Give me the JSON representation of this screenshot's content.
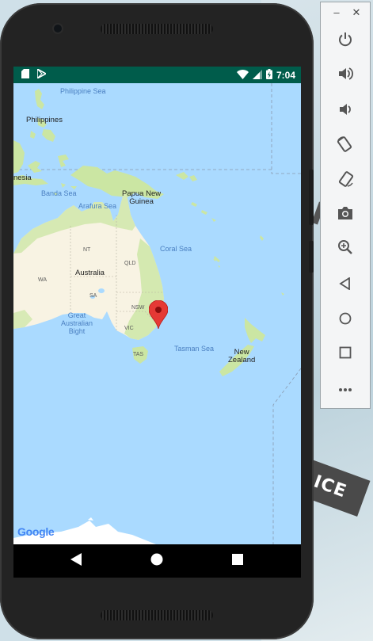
{
  "status_bar": {
    "time": "7:04"
  },
  "map": {
    "labels": {
      "philippine_sea": "Philippine Sea",
      "philippines": "Philippines",
      "indonesia": "nesia",
      "banda_sea": "Banda Sea",
      "arafura_sea": "Arafura Sea",
      "papua_new_guinea": "Papua New\nGuinea",
      "coral_sea": "Coral Sea",
      "nt": "NT",
      "qld": "QLD",
      "wa": "WA",
      "australia": "Australia",
      "sa": "SA",
      "nsw": "NSW",
      "great_australian_bight": "Great\nAustralian\nBight",
      "vic": "VIC",
      "tas": "TAS",
      "tasman_sea": "Tasman Sea",
      "new_zealand": "New\nZealand"
    },
    "attribution": "Google",
    "colors": {
      "water": "#aadaff",
      "land": "#f8f3e3",
      "vegetation": "#cbe6a3",
      "marker": "#e53935"
    }
  },
  "desktop": {
    "tag_text": "ICE"
  },
  "icons": {
    "status_left": [
      "sd-card-icon",
      "play-store-icon"
    ],
    "status_right": [
      "wifi-icon",
      "signal-icon",
      "battery-charging-icon"
    ],
    "nav": [
      "back-icon",
      "home-icon",
      "recents-icon"
    ],
    "toolbar": [
      "power-icon",
      "volume-up-icon",
      "volume-down-icon",
      "rotate-left-icon",
      "rotate-right-icon",
      "camera-icon",
      "zoom-icon",
      "back-icon",
      "home-icon",
      "overview-icon",
      "more-icon"
    ]
  }
}
